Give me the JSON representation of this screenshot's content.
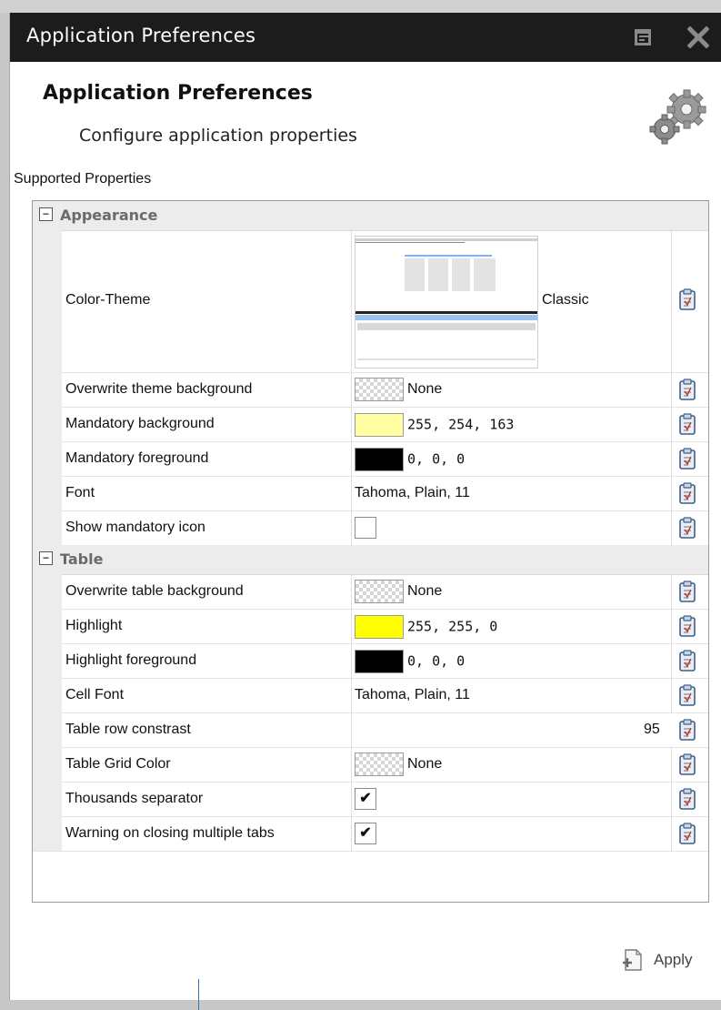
{
  "window": {
    "title": "Application Preferences"
  },
  "header": {
    "title": "Application Preferences",
    "subtitle": "Configure application properties"
  },
  "section_label": "Supported Properties",
  "categories": [
    {
      "label": "Appearance",
      "toggle": "−",
      "rows": [
        {
          "name": "Color-Theme",
          "value": "Classic"
        },
        {
          "name": "Overwrite theme background",
          "value": "None",
          "swatch": "none"
        },
        {
          "name": "Mandatory background",
          "value": "255, 254, 163",
          "swatch": "#fffea3"
        },
        {
          "name": "Mandatory foreground",
          "value": "0, 0, 0",
          "swatch": "#000000"
        },
        {
          "name": "Font",
          "value": "Tahoma, Plain, 11"
        },
        {
          "name": "Show mandatory icon",
          "checkbox": false
        }
      ]
    },
    {
      "label": "Table",
      "toggle": "−",
      "rows": [
        {
          "name": "Overwrite table background",
          "value": "None",
          "swatch": "none"
        },
        {
          "name": "Highlight",
          "value": "255, 255, 0",
          "swatch": "#ffff00"
        },
        {
          "name": "Highlight foreground",
          "value": "0, 0, 0",
          "swatch": "#000000"
        },
        {
          "name": "Cell Font",
          "value": "Tahoma, Plain, 11"
        },
        {
          "name": "Table row constrast",
          "value": "95"
        },
        {
          "name": "Table Grid Color",
          "value": "None",
          "swatch": "none"
        },
        {
          "name": "Thousands separator",
          "checkbox": true,
          "mark": "✔"
        },
        {
          "name": "Warning on closing multiple tabs",
          "checkbox": true,
          "mark": "✔"
        }
      ]
    }
  ],
  "apply_label": "Apply"
}
